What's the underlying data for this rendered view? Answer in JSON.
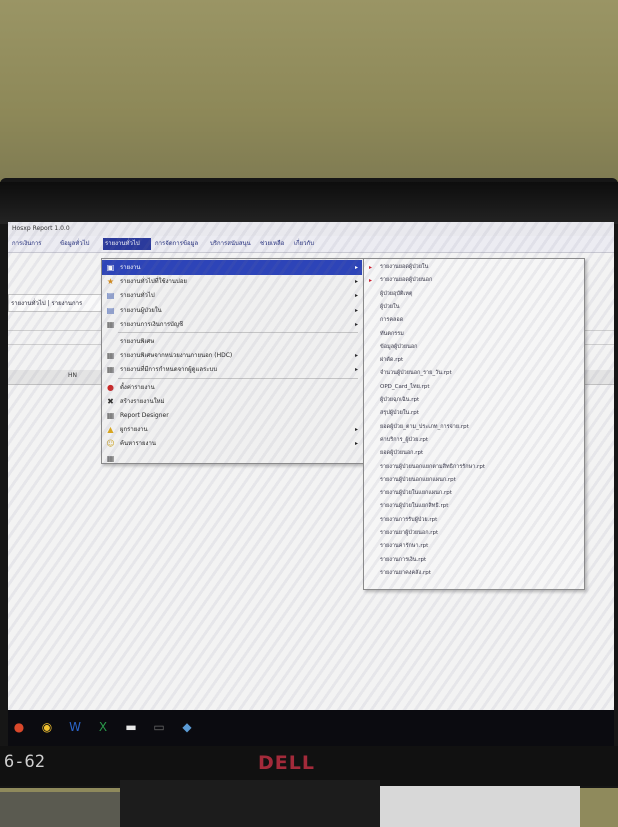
{
  "window": {
    "title": "Hosxp Report 1.0.0"
  },
  "menubar": {
    "items": [
      {
        "label": "การเงินการ"
      },
      {
        "label": "ข้อมูลทั่วไป"
      },
      {
        "label": "รายงานทั่วไป"
      },
      {
        "label": "การจัดการข้อมูล"
      },
      {
        "label": "บริการสนับสนุน"
      },
      {
        "label": "ช่วยเหลือ"
      },
      {
        "label": "เกี่ยวกับ"
      }
    ],
    "active_index": 2
  },
  "content": {
    "left_field": "รายงานทั่วไป | รายงานการ",
    "header_text": "HN"
  },
  "dropdown": {
    "items": [
      {
        "label": "รายงาน",
        "icon": "folder-icon",
        "has_submenu": true,
        "highlighted": true
      },
      {
        "label": "รายงานทั่วไปที่ใช้งานบ่อย",
        "icon": "star-icon",
        "has_submenu": true
      },
      {
        "label": "รายงานทั่วไป",
        "icon": "report-icon",
        "has_submenu": true
      },
      {
        "label": "รายงานผู้ป่วยใน",
        "icon": "report-icon",
        "has_submenu": true
      },
      {
        "label": "รายงานการเงินการบัญชี",
        "icon": "document-icon",
        "has_submenu": true
      },
      {
        "label": "รายงานพิเศษ",
        "icon": "",
        "has_submenu": false
      },
      {
        "label": "รายงานพิเศษจากหน่วยงานภายนอก (HDC)",
        "icon": "document-icon",
        "has_submenu": true
      },
      {
        "label": "รายงานที่มีการกำหนดจากผู้ดูแลระบบ",
        "icon": "document-icon",
        "has_submenu": true
      },
      {
        "label": "ตั้งค่ารายงาน",
        "icon": "stop-icon",
        "has_submenu": false
      },
      {
        "label": "สร้างรายงานใหม่",
        "icon": "tools-icon",
        "has_submenu": false
      },
      {
        "label": "Report Designer",
        "icon": "document-icon",
        "has_submenu": false
      },
      {
        "label": "ผูกรายงาน",
        "icon": "lock-icon",
        "has_submenu": true
      },
      {
        "label": "ค้นหารายงาน",
        "icon": "user-icon",
        "has_submenu": true
      },
      {
        "label": "",
        "icon": "document-icon",
        "has_submenu": false
      }
    ]
  },
  "submenu": {
    "items": [
      "รายงานยอดผู้ป่วยใน",
      "รายงานยอดผู้ป่วยนอก",
      "ผู้ป่วยอุบัติเหตุ",
      "ผู้ป่วยใน",
      "การคลอด",
      "ทันตกรรม",
      "ข้อมูลผู้ป่วยนอก",
      "ผ่าตัด.rpt",
      "จำนวนผู้ป่วยนอก_ราย_วัน.rpt",
      "OPD_Card_ไทย.rpt",
      "ผู้ป่วยฉุกเฉิน.rpt",
      "สรุปผู้ป่วยใน.rpt",
      "ยอดผู้ป่วย_ตาม_ประเภท_การจ่าย.rpt",
      "ค่าบริการ_ผู้ป่วย.rpt",
      "ยอดผู้ป่วยนอก.rpt",
      "รายงานผู้ป่วยนอกแยกตามสิทธิการรักษา.rpt",
      "รายงานผู้ป่วยนอกแยกแผนก.rpt",
      "รายงานผู้ป่วยในแยกแผนก.rpt",
      "รายงานผู้ป่วยในแยกสิทธิ.rpt",
      "รายงานการรับผู้ป่วย.rpt",
      "รายงานยาผู้ป่วยนอก.rpt",
      "รายงานค่ารักษา.rpt",
      "รายงานการเงิน.rpt",
      "รายงานยาคงคลัง.rpt"
    ]
  },
  "taskbar": {
    "apps": [
      {
        "icon": "start-icon",
        "color": "#d9482b"
      },
      {
        "icon": "chrome-icon",
        "color": "#f2c230"
      },
      {
        "icon": "word-icon",
        "color": "#2b64c8"
      },
      {
        "icon": "excel-icon",
        "color": "#2a9a4a"
      },
      {
        "icon": "folder-icon",
        "color": "#e8e8e8"
      },
      {
        "icon": "terminal-icon",
        "color": "#6a6a6a"
      },
      {
        "icon": "app-icon",
        "color": "#5b9bd5"
      }
    ]
  },
  "monitor": {
    "brand": "DELL",
    "sticker": "6-62"
  }
}
